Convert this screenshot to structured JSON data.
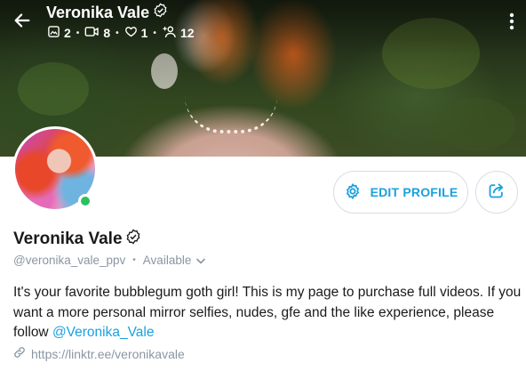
{
  "header": {
    "title": "Veronika Vale",
    "stats": [
      {
        "icon": "image-icon",
        "value": "2"
      },
      {
        "icon": "video-icon",
        "value": "8"
      },
      {
        "icon": "heart-icon",
        "value": "1"
      },
      {
        "icon": "fans-icon",
        "value": "12"
      }
    ]
  },
  "profile": {
    "name": "Veronika Vale",
    "handle": "@veronika_vale_ppv",
    "status": "Available",
    "online": true,
    "bio_text": "It's your favorite bubblegum goth girl! This is my page to purchase full videos. If you want a more personal mirror selfies, nudes, gfe and the like experience, please follow ",
    "bio_mention": "@Veronika_Vale",
    "link": "https://linktr.ee/veronikavale"
  },
  "actions": {
    "edit_profile_label": "EDIT PROFILE"
  },
  "colors": {
    "accent": "#1aa0e0",
    "online": "#2dbf5d",
    "muted": "#8a96a3"
  }
}
